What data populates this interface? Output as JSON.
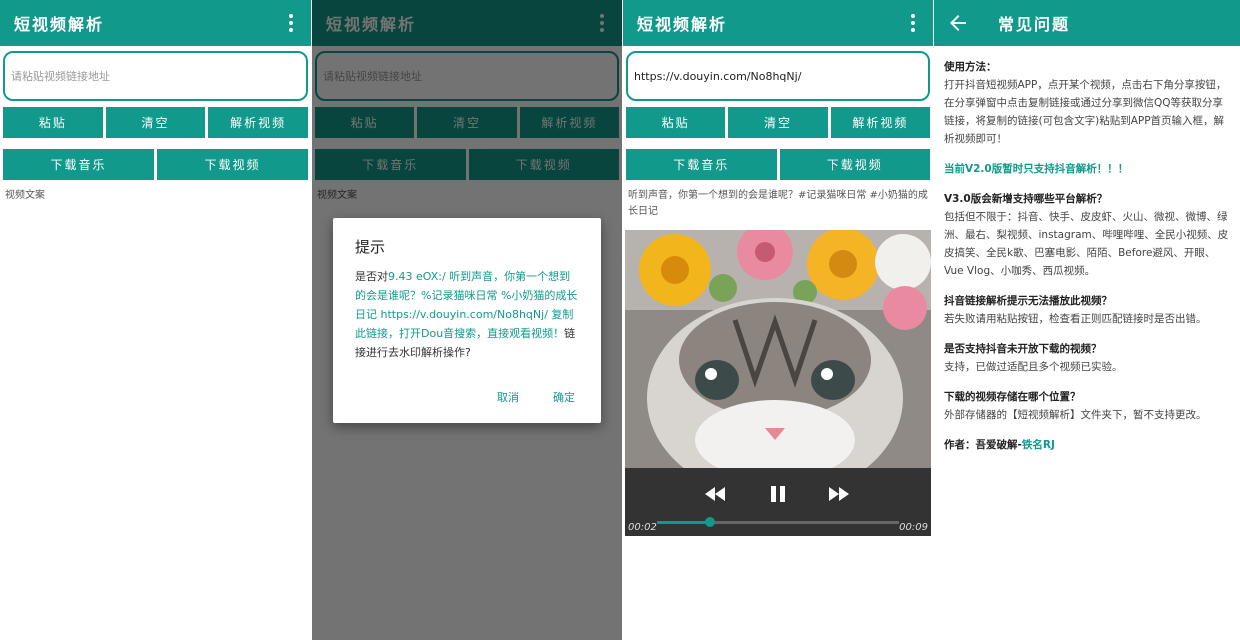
{
  "app_title": "短视频解析",
  "main": {
    "url_placeholder": "请粘贴视频链接地址",
    "paste_label": "粘贴",
    "clear_label": "清空",
    "parse_label": "解析视频",
    "download_music_label": "下载音乐",
    "download_video_label": "下载视频",
    "caption_placeholder": "视频文案"
  },
  "dialog": {
    "title": "提示",
    "msg_prefix": "是否对",
    "msg_highlight1": "9.43 eOX:/ 听到声音，你第一个想到的会是谁呢？%记录猫咪日常 %小奶猫的成长日记 https://v.douyin.com/No8hqNj/ 复制此链接，打开Dou音搜索，直接观看视频！",
    "msg_suffix": "链接进行去水印解析操作?",
    "cancel_label": "取消",
    "confirm_label": "确定"
  },
  "result": {
    "url_value": "https://v.douyin.com/No8hqNj/",
    "caption": "听到声音，你第一个想到的会是谁呢？#记录猫咪日常 #小奶猫的成长日记",
    "time_current": "00:02",
    "time_total": "00:09",
    "progress_fraction": 0.22
  },
  "faq": {
    "title": "常见问题",
    "usage_heading": "使用方法：",
    "usage_body": "打开抖音短视频APP，点开某个视频，点击右下角分享按钮，在分享弹窗中点击复制链接或通过分享到微信QQ等获取分享链接，将复制的链接(可包含文字)粘贴到APP首页输入框，解析视频即可！",
    "notice": "当前V2.0版暂时只支持抖音解析！！！",
    "q1": "V3.0版会新增支持哪些平台解析？",
    "a1": "包括但不限于：抖音、快手、皮皮虾、火山、微视、微博、绿洲、最右、梨视频、instagram、哔哩哔哩、全民小视频、皮皮搞笑、全民k歌、巴塞电影、陌陌、Before避风、开眼、Vue Vlog、小咖秀、西瓜视频。",
    "q2": "抖音链接解析提示无法播放此视频？",
    "a2": "若失败请用粘贴按钮，检查看正则匹配链接时是否出错。",
    "q3": "是否支持抖音未开放下载的视频？",
    "a3": "支持，已做过适配且多个视频已实验。",
    "q4": "下载的视频存储在哪个位置？",
    "a4": "外部存储器的【短视频解析】文件夹下，暂不支持更改。",
    "author_label": "作者：吾爱破解-",
    "author_name": "铁名RJ"
  },
  "colors": {
    "accent": "#119a8b"
  }
}
